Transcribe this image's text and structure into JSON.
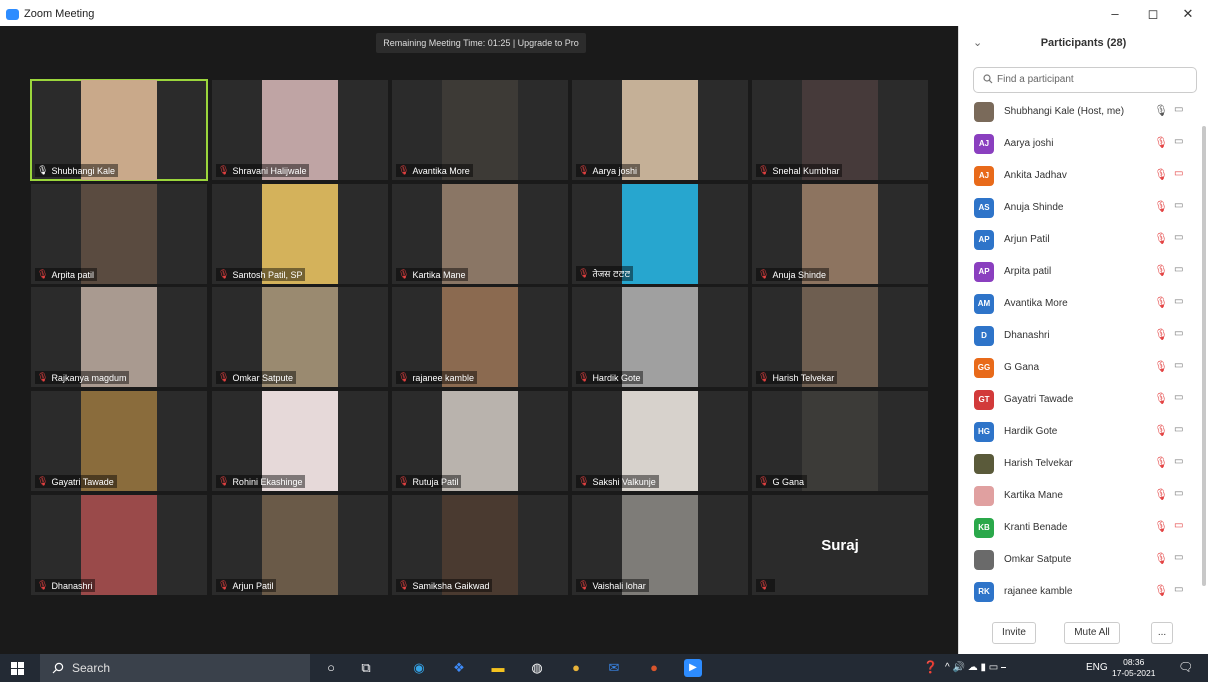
{
  "window": {
    "title": "Zoom Meeting",
    "min": "–",
    "max": "◻",
    "close": "✕"
  },
  "banner": "Remaining Meeting Time: 01:25 | Upgrade to Pro",
  "colors": {
    "accent": "#2d8cff",
    "active_speaker": "#9bd63c",
    "muted": "#e34040"
  },
  "tiles": [
    {
      "name": "Shubhangi Kale",
      "muted": false,
      "active": true,
      "video": "#c9a98a"
    },
    {
      "name": "Shravani Halijwale",
      "muted": true,
      "video": "#bfa4a4"
    },
    {
      "name": "Avantika More",
      "muted": true,
      "video": "#3d3a36"
    },
    {
      "name": "Aarya joshi",
      "muted": true,
      "video": "#c5b097"
    },
    {
      "name": "Snehal Kumbhar",
      "muted": true,
      "video": "#463a3a"
    },
    {
      "name": "Arpita patil",
      "muted": true,
      "video": "#5a4b40"
    },
    {
      "name": "Santosh Patil, SP",
      "muted": true,
      "video": "#d4b25b"
    },
    {
      "name": "Kartika Mane",
      "muted": true,
      "video": "#8a7665"
    },
    {
      "name": "तेजस ꯂꯂꯂ",
      "muted": true,
      "video": "#27a6cf"
    },
    {
      "name": "Anuja Shinde",
      "muted": true,
      "video": "#8d7460"
    },
    {
      "name": "Rajkanya magdum",
      "muted": true,
      "video": "#a99a90"
    },
    {
      "name": "Omkar Satpute",
      "muted": true,
      "video": "#9a8a70"
    },
    {
      "name": "rajanee kamble",
      "muted": true,
      "video": "#8b6a50"
    },
    {
      "name": "Hardik Gote",
      "muted": true,
      "video": "#a0a0a0"
    },
    {
      "name": "Harish Telvekar",
      "muted": true,
      "video": "#6e5e50"
    },
    {
      "name": "Gayatri Tawade",
      "muted": true,
      "video": "#8a6c3c"
    },
    {
      "name": "Rohini Ekashinge",
      "muted": true,
      "video": "#e6d9d9"
    },
    {
      "name": "Rutuja Patil",
      "muted": true,
      "video": "#b9b3ad"
    },
    {
      "name": "Sakshi Valkunje",
      "muted": true,
      "video": "#d7d2cc"
    },
    {
      "name": "G Gana",
      "muted": true,
      "video": "#3c3b38"
    },
    {
      "name": "Dhanashri",
      "muted": true,
      "video": "#9a4a4a"
    },
    {
      "name": "Arjun Patil",
      "muted": true,
      "video": "#6a5a48"
    },
    {
      "name": "Samiksha Gaikwad",
      "muted": true,
      "video": "#4a3a30"
    },
    {
      "name": "Vaishali lohar",
      "muted": true,
      "video": "#7e7c78"
    },
    {
      "name": "",
      "muted": true,
      "video": "",
      "big_name": "Suraj"
    }
  ],
  "panel": {
    "chevron": "⌄",
    "title": "Participants (28)",
    "search_icon": "search-icon",
    "search_placeholder": "Find a participant",
    "participants": [
      {
        "name": "Shubhangi Kale (Host, me)",
        "initials": "",
        "color": "#7a6a5a",
        "mic": "on",
        "cam": "on"
      },
      {
        "name": "Aarya joshi",
        "initials": "AJ",
        "color": "#8a3fbf",
        "mic": "off",
        "cam": "on"
      },
      {
        "name": "Ankita Jadhav",
        "initials": "AJ",
        "color": "#e86a1a",
        "mic": "off",
        "cam": "off"
      },
      {
        "name": "Anuja Shinde",
        "initials": "AS",
        "color": "#2e74c9",
        "mic": "off",
        "cam": "on"
      },
      {
        "name": "Arjun Patil",
        "initials": "AP",
        "color": "#2e74c9",
        "mic": "off",
        "cam": "on"
      },
      {
        "name": "Arpita patil",
        "initials": "AP",
        "color": "#8a3fbf",
        "mic": "off",
        "cam": "on"
      },
      {
        "name": "Avantika More",
        "initials": "AM",
        "color": "#2e74c9",
        "mic": "off",
        "cam": "on"
      },
      {
        "name": "Dhanashri",
        "initials": "D",
        "color": "#2e74c9",
        "mic": "off",
        "cam": "on"
      },
      {
        "name": "G Gana",
        "initials": "GG",
        "color": "#e86a1a",
        "mic": "off",
        "cam": "on"
      },
      {
        "name": "Gayatri Tawade",
        "initials": "GT",
        "color": "#d23a3a",
        "mic": "off",
        "cam": "on"
      },
      {
        "name": "Hardik Gote",
        "initials": "HG",
        "color": "#2e74c9",
        "mic": "off",
        "cam": "on"
      },
      {
        "name": "Harish Telvekar",
        "initials": "",
        "color": "#5a5a3a",
        "mic": "off",
        "cam": "on"
      },
      {
        "name": "Kartika Mane",
        "initials": "",
        "color": "#e0a0a0",
        "mic": "off",
        "cam": "on"
      },
      {
        "name": "Kranti Benade",
        "initials": "KB",
        "color": "#2aa84a",
        "mic": "off",
        "cam": "off"
      },
      {
        "name": "Omkar Satpute",
        "initials": "",
        "color": "#6a6a6a",
        "mic": "off",
        "cam": "on"
      },
      {
        "name": "rajanee kamble",
        "initials": "RK",
        "color": "#2e74c9",
        "mic": "off",
        "cam": "on"
      }
    ],
    "invite": "Invite",
    "mute_all": "Mute All",
    "more": "..."
  },
  "taskbar": {
    "search": "Search",
    "apps": [
      "task-view-icon",
      "file-explorer-icon",
      "edge-icon",
      "dropbox-icon",
      "store-icon",
      "chrome-icon",
      "mail-icon",
      "powerpoint-icon",
      "zoom-icon"
    ],
    "lang": "ENG",
    "time": "08:36",
    "date": "17-05-2021"
  }
}
